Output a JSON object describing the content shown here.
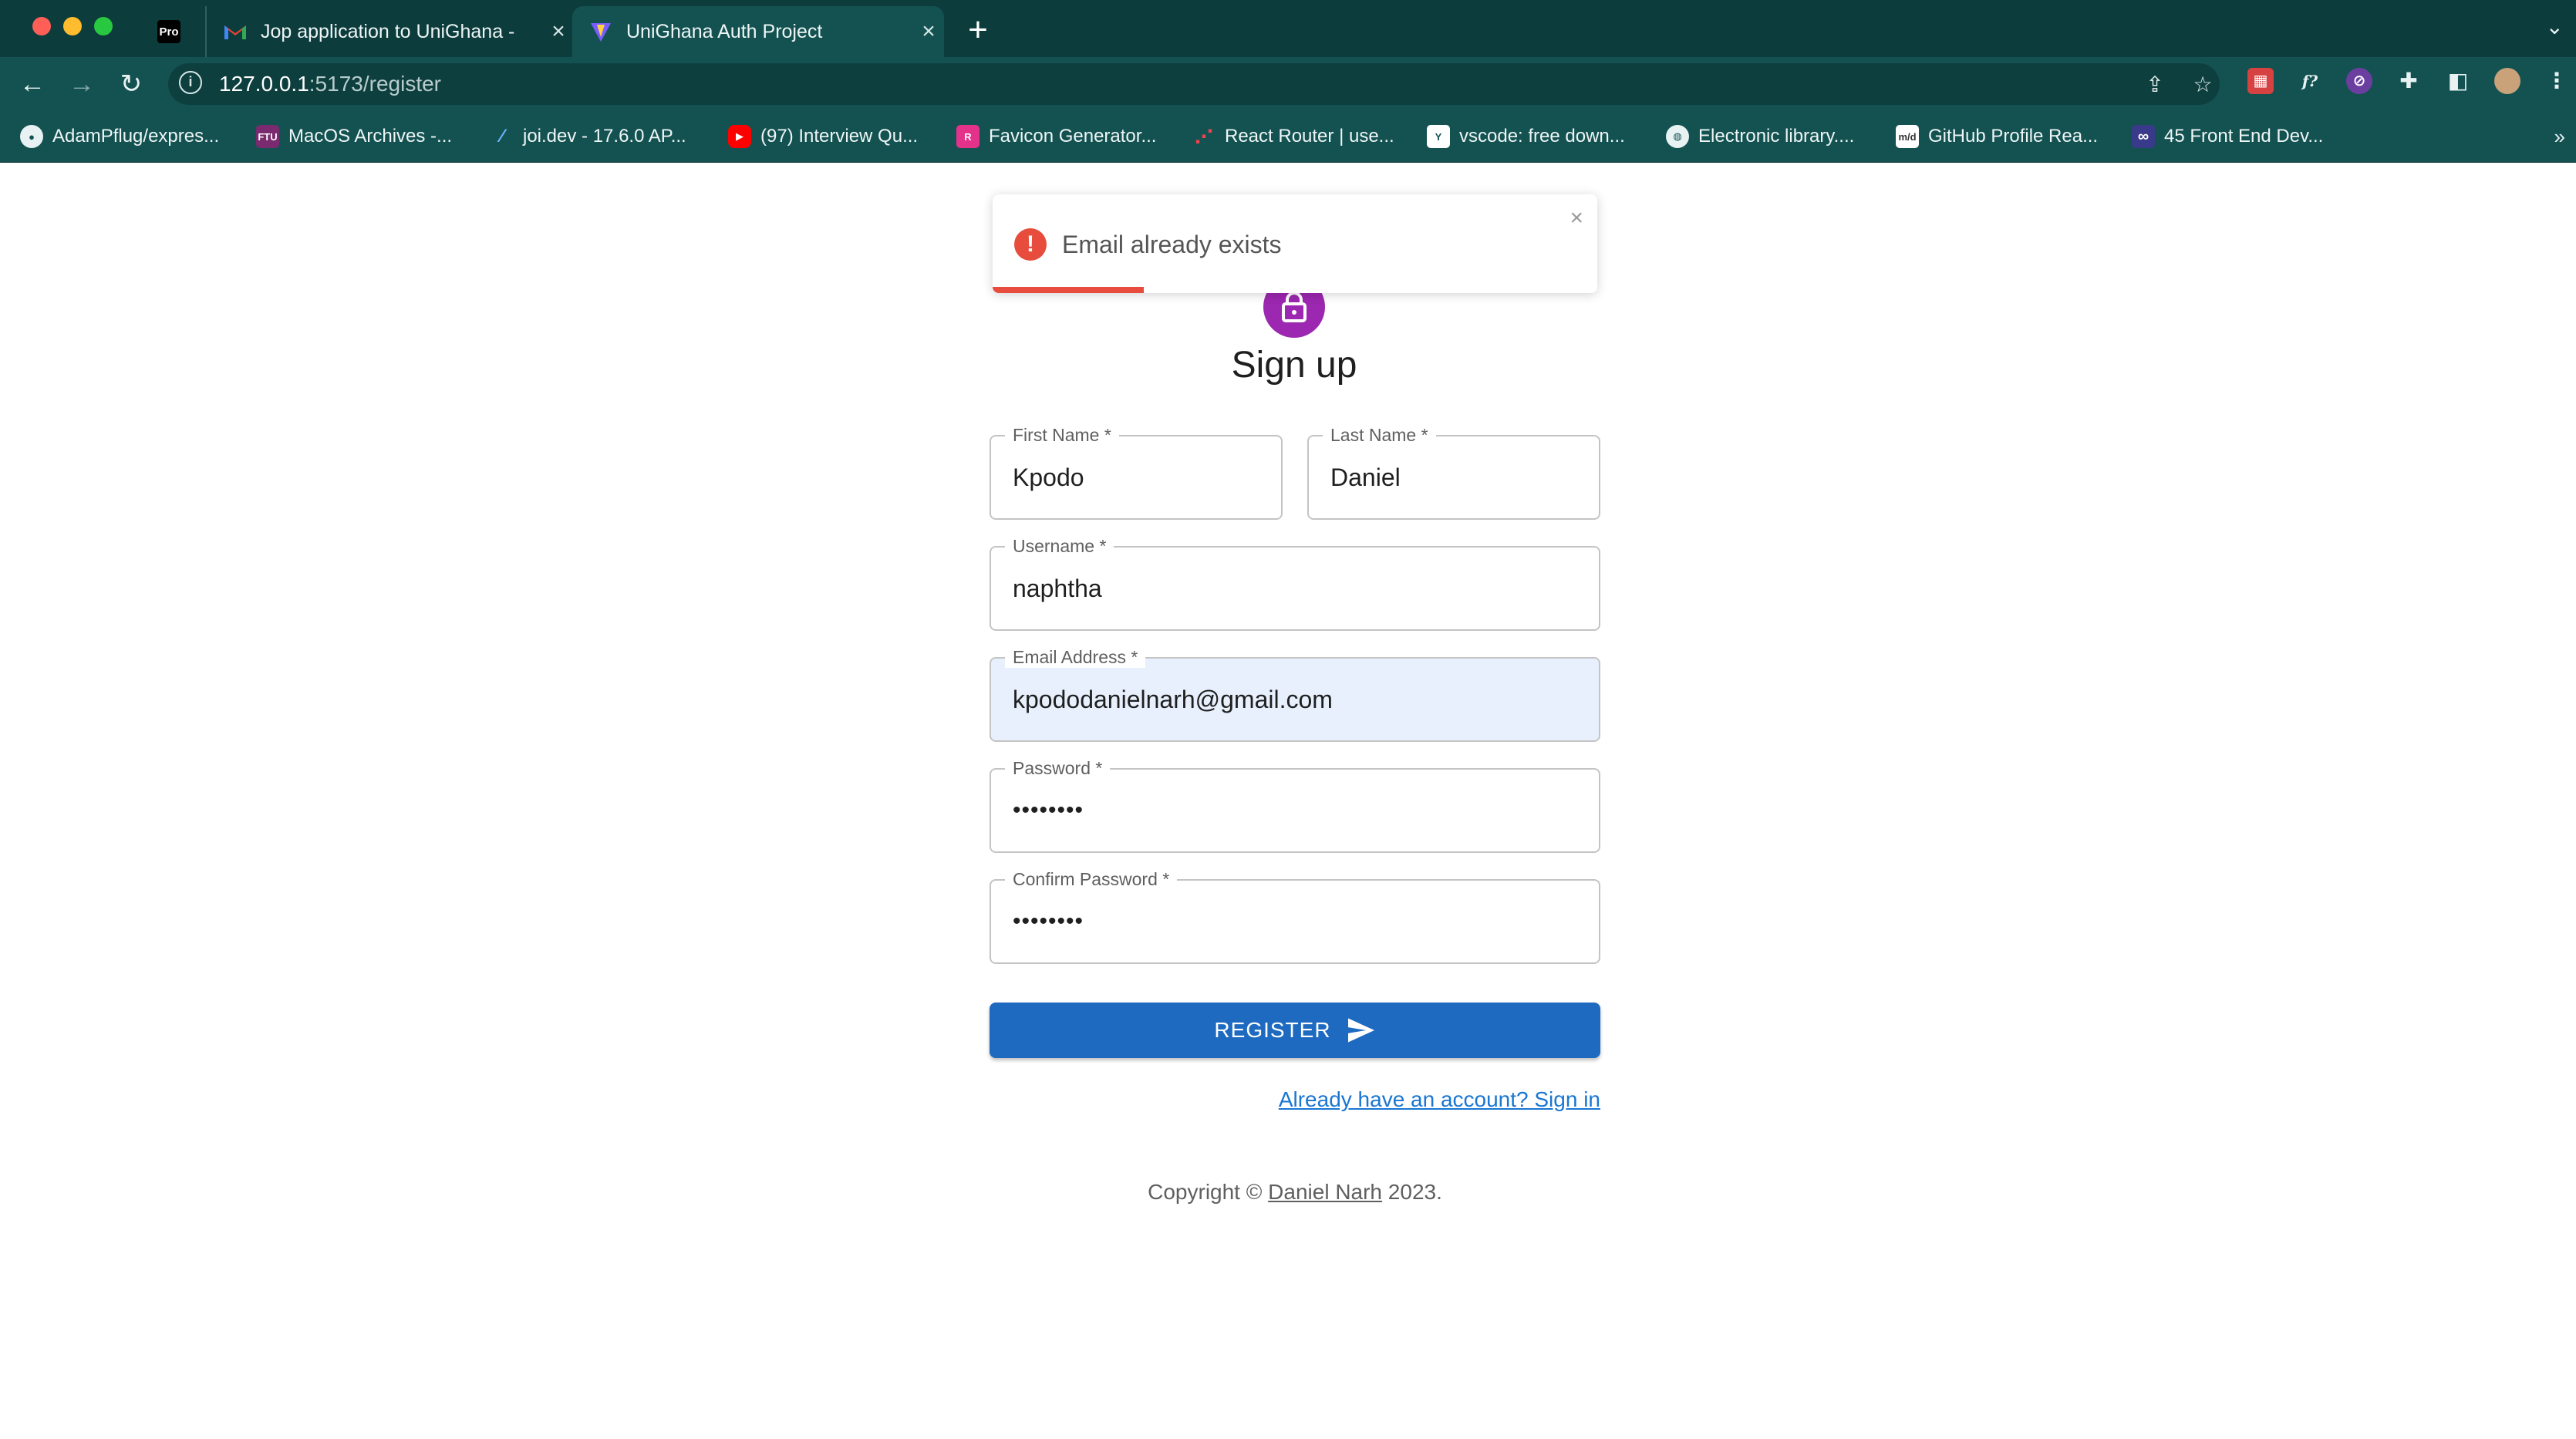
{
  "browser": {
    "tabs": [
      {
        "favicon": "Pro",
        "title": ""
      },
      {
        "favicon": "gmail-icon",
        "title": "Jop application to UniGhana - "
      },
      {
        "favicon": "vite-icon",
        "title": "UniGhana Auth Project"
      }
    ],
    "url_host": "127.0.0.1",
    "url_path": ":5173/register",
    "bookmarks": [
      "AdamPflug/expres...",
      "MacOS Archives -...",
      "joi.dev - 17.6.0 AP...",
      "(97) Interview Qu...",
      "Favicon Generator...",
      "React Router | use...",
      "vscode: free down...",
      "Electronic library....",
      "GitHub Profile Rea...",
      "45 Front End Dev..."
    ],
    "bookmark_icons": [
      "FTU",
      "R",
      "Y",
      "m/d"
    ]
  },
  "toast": {
    "message": "Email already exists",
    "progress": 0.25,
    "color": "#e74c3c"
  },
  "form": {
    "title": "Sign up",
    "first_name": {
      "label": "First Name *",
      "value": "Kpodo"
    },
    "last_name": {
      "label": "Last Name *",
      "value": "Daniel"
    },
    "username": {
      "label": "Username *",
      "value": "naphtha"
    },
    "email": {
      "label": "Email Address *",
      "value": "kpododanielnarh@gmail.com"
    },
    "password": {
      "label": "Password *",
      "value": "••••••••"
    },
    "confirm_password": {
      "label": "Confirm Password *",
      "value": "••••••••"
    },
    "register_label": "REGISTER",
    "signin_link": "Already have an account? Sign in"
  },
  "footer": {
    "prefix": "Copyright © ",
    "name": "Daniel Narh",
    "suffix": " 2023."
  },
  "colors": {
    "primary": "#1e6ac0",
    "avatar": "#9c27b0",
    "chrome": "#145252"
  }
}
